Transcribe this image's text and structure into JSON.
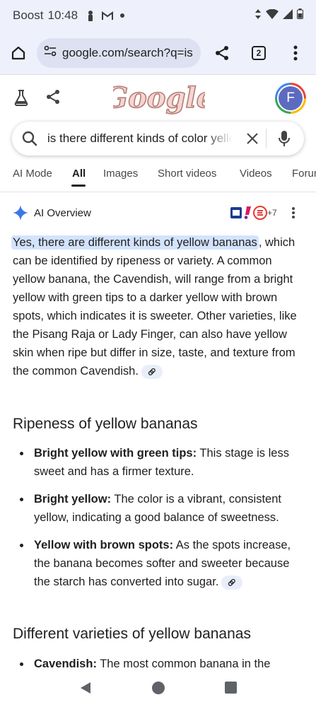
{
  "status_bar": {
    "carrier": "Boost",
    "time": "10:48"
  },
  "browser": {
    "url": "google.com/search?q=is",
    "tab_count": "2"
  },
  "google_logo": {
    "text": "Google"
  },
  "account": {
    "initial": "F"
  },
  "search": {
    "query": "is there different kinds of color yellow bananas"
  },
  "tabs": [
    {
      "label": "AI Mode"
    },
    {
      "label": "All"
    },
    {
      "label": "Images"
    },
    {
      "label": "Short videos"
    },
    {
      "label": "Videos"
    },
    {
      "label": "Forums"
    }
  ],
  "ai_overview": {
    "title": "AI Overview",
    "sources_more": "+7",
    "intro_highlight": "Yes, there are different kinds of yellow bananas",
    "intro_rest": ", which can be identified by ripeness or variety. A common yellow banana, the Cavendish, will range from a bright yellow with green tips to a darker yellow with brown spots, which indicates it is sweeter. Other varieties, like the Pisang Raja or Lady Finger, can also have yellow skin when ripe but differ in size, taste, and texture from the common Cavendish."
  },
  "ripeness": {
    "heading": "Ripeness of yellow bananas",
    "items": [
      {
        "term": "Bright yellow with green tips:",
        "text": " This stage is less sweet and has a firmer texture."
      },
      {
        "term": "Bright yellow:",
        "text": " The color is a vibrant, consistent yellow, indicating a good balance of sweetness."
      },
      {
        "term": "Yellow with brown spots:",
        "text": " As the spots increase, the banana becomes softer and sweeter because the starch has converted into sugar."
      }
    ]
  },
  "varieties": {
    "heading": "Different varieties of yellow bananas",
    "items": [
      {
        "term": "Cavendish:",
        "text": " The most common banana in the"
      }
    ]
  },
  "colors": {
    "chrome_bg": "#eef0fb",
    "highlight": "#d3e3fd",
    "avatar": "#5c6bc0",
    "logo_pink": "#d9a6a0"
  }
}
